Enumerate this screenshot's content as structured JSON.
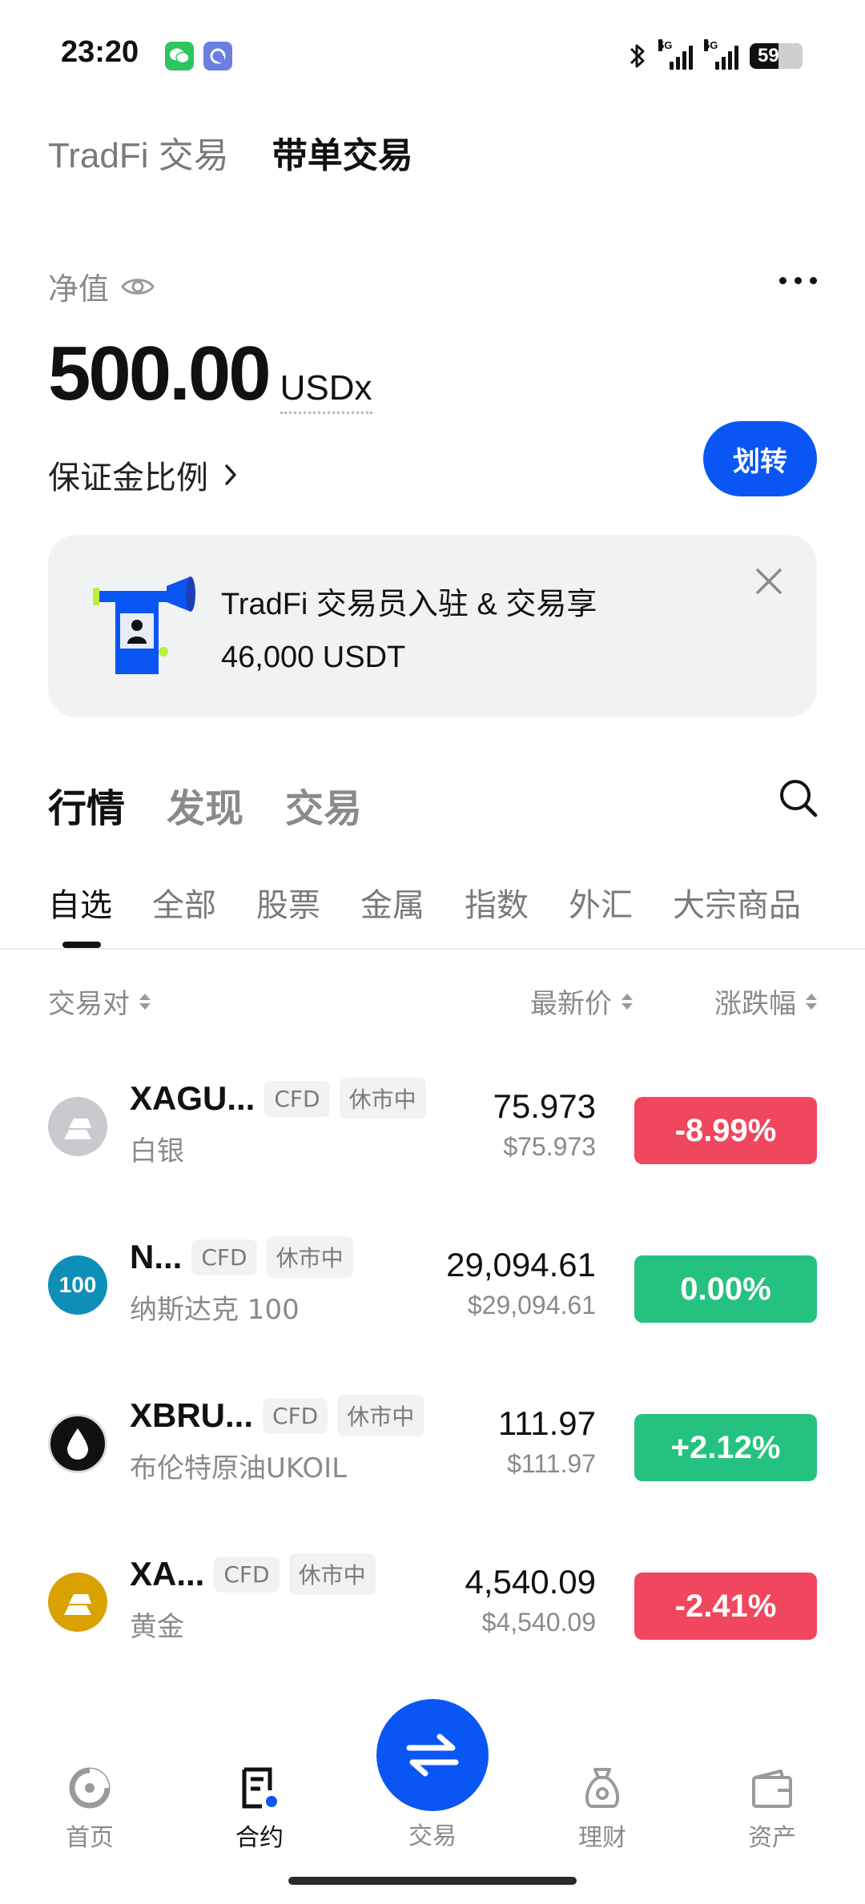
{
  "status_bar": {
    "time": "23:20",
    "battery_level": "59",
    "network_1": "5G",
    "network_2": "5G",
    "icons": [
      "wechat-icon",
      "app-icon",
      "bluetooth-icon",
      "signal-icon",
      "battery-icon"
    ]
  },
  "top_tabs": [
    {
      "label": "TradFi 交易",
      "active": false
    },
    {
      "label": "带单交易",
      "active": true
    }
  ],
  "net_value": {
    "label": "净值",
    "amount": "500.00",
    "unit": "USDx",
    "margin_ratio_label": "保证金比例",
    "transfer_label": "划转"
  },
  "banner": {
    "line1": "TradFi 交易员入驻 & 交易享",
    "line2": "46,000 USDT"
  },
  "section_tabs": [
    {
      "label": "行情",
      "active": true
    },
    {
      "label": "发现",
      "active": false
    },
    {
      "label": "交易",
      "active": false
    }
  ],
  "category_tabs": [
    {
      "label": "自选",
      "active": true
    },
    {
      "label": "全部",
      "active": false
    },
    {
      "label": "股票",
      "active": false
    },
    {
      "label": "金属",
      "active": false
    },
    {
      "label": "指数",
      "active": false
    },
    {
      "label": "外汇",
      "active": false
    },
    {
      "label": "大宗商品",
      "active": false
    }
  ],
  "columns": {
    "pair": "交易对",
    "last_price": "最新价",
    "change": "涨跌幅"
  },
  "colors": {
    "accent": "#0a56f5",
    "down": "#f0475f",
    "up": "#25c27f",
    "flat": "#25c27f"
  },
  "rows": [
    {
      "symbol": "XAGU...",
      "tag1": "CFD",
      "tag2": "休市中",
      "name": "白银",
      "price": "75.973",
      "price_usd": "$75.973",
      "change": "-8.99%",
      "direction": "down",
      "logo": "silver-icon"
    },
    {
      "symbol": "N...",
      "tag1": "CFD",
      "tag2": "休市中",
      "name": "纳斯达克 100",
      "price": "29,094.61",
      "price_usd": "$29,094.61",
      "change": "0.00%",
      "direction": "flat",
      "logo": "nasdaq-100-icon",
      "logo_text": "100"
    },
    {
      "symbol": "XBRU...",
      "tag1": "CFD",
      "tag2": "休市中",
      "name": "布伦特原油UKOIL",
      "price": "111.97",
      "price_usd": "$111.97",
      "change": "+2.12%",
      "direction": "up",
      "logo": "oil-drop-icon"
    },
    {
      "symbol": "XA...",
      "tag1": "CFD",
      "tag2": "休市中",
      "name": "黄金",
      "price": "4,540.09",
      "price_usd": "$4,540.09",
      "change": "-2.41%",
      "direction": "down",
      "logo": "gold-icon"
    }
  ],
  "bottom_nav": [
    {
      "label": "首页",
      "icon": "home-icon",
      "active": false
    },
    {
      "label": "合约",
      "icon": "contract-icon",
      "active": true
    },
    {
      "label": "交易",
      "icon": "swap-icon",
      "active": false
    },
    {
      "label": "理财",
      "icon": "finance-icon",
      "active": false
    },
    {
      "label": "资产",
      "icon": "wallet-icon",
      "active": false
    }
  ]
}
